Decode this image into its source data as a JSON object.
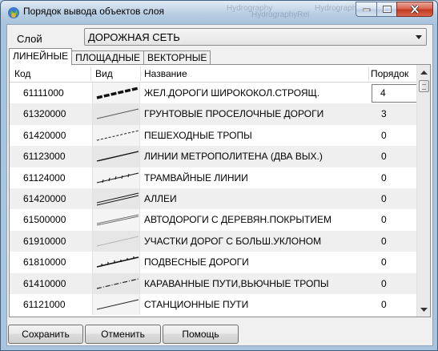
{
  "window": {
    "title": "Порядок вывода объектов слоя",
    "background_text": [
      "Hydrography",
      "HydrographyRel",
      "Hydrography"
    ]
  },
  "layer": {
    "label": "Слой",
    "selected": "ДОРОЖНАЯ СЕТЬ"
  },
  "tabs": [
    {
      "label": "ЛИНЕЙНЫЕ",
      "active": true
    },
    {
      "label": "ПЛОЩАДНЫЕ",
      "active": false
    },
    {
      "label": "ВЕКТОРНЫЕ",
      "active": false
    }
  ],
  "table": {
    "columns": [
      "Код",
      "Вид",
      "Название",
      "Порядок"
    ],
    "rows": [
      {
        "code": "61111000",
        "name": "ЖЕЛ.ДОРОГИ ШИРОКОКОЛ.СТРОЯЩ.",
        "order": "4",
        "view_style": "thick-dashed"
      },
      {
        "code": "61320000",
        "name": "ГРУНТОВЫЕ ПРОСЕЛОЧНЫЕ ДОРОГИ",
        "order": "3",
        "view_style": "thin-solid"
      },
      {
        "code": "61420000",
        "name": "ПЕШЕХОДНЫЕ ТРОПЫ",
        "order": "0",
        "view_style": "dashed"
      },
      {
        "code": "61123000",
        "name": "ЛИНИИ МЕТРОПОЛИТЕНА (ДВА ВЫХ.)",
        "order": "0",
        "view_style": "solid"
      },
      {
        "code": "61124000",
        "name": "ТРАМВАЙНЫЕ ЛИНИИ",
        "order": "0",
        "view_style": "ticked"
      },
      {
        "code": "61420000",
        "name": "АЛЛЕИ",
        "order": "0",
        "view_style": "double"
      },
      {
        "code": "61500000",
        "name": "АВТОДОРОГИ С ДЕРЕВЯН.ПОКРЫТИЕМ",
        "order": "0",
        "view_style": "double-thin"
      },
      {
        "code": "61910000",
        "name": "УЧАСТКИ ДОРОГ С БОЛЬШ.УКЛОНОМ",
        "order": "0",
        "view_style": "faint"
      },
      {
        "code": "61810000",
        "name": "ПОДВЕСНЫЕ ДОРОГИ",
        "order": "0",
        "view_style": "dotted-solid"
      },
      {
        "code": "61410000",
        "name": "КАРАВАННЫЕ ПУТИ,ВЬЮЧНЫЕ ТРОПЫ",
        "order": "0",
        "view_style": "dash-dot"
      },
      {
        "code": "61121000",
        "name": "СТАНЦИОННЫЕ ПУТИ",
        "order": "0",
        "view_style": "solid-thin"
      }
    ]
  },
  "buttons": {
    "save": "Сохранить",
    "cancel": "Отменить",
    "help": "Помощь"
  },
  "colors": {
    "frame": "#b9cde0",
    "client": "#f0f0f0",
    "close_button": "#c9452c"
  }
}
